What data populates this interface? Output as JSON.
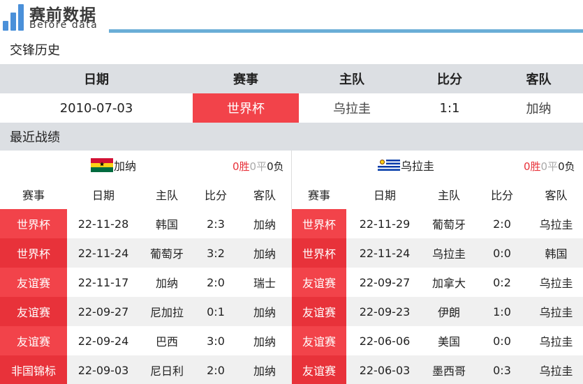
{
  "header": {
    "title": "赛前数据",
    "subtitle": "Before data",
    "accent": "#4a90d9"
  },
  "h2h": {
    "section_title": "交锋历史",
    "columns": [
      "日期",
      "赛事",
      "主队",
      "比分",
      "客队"
    ],
    "row": {
      "date": "2010-07-03",
      "competition": "世界杯",
      "home": "乌拉圭",
      "score": "1:1",
      "away": "加纳"
    }
  },
  "recent": {
    "section_title": "最近战绩",
    "columns": [
      "赛事",
      "日期",
      "主队",
      "比分",
      "客队"
    ],
    "left": {
      "team": "加纳",
      "flag": "ghana-flag",
      "record": {
        "win": "0胜",
        "draw": "0平",
        "loss": "0负"
      },
      "matches": [
        {
          "competition": "世界杯",
          "date": "22-11-28",
          "home": "韩国",
          "score": "2:3",
          "away": "加纳",
          "color": "#f2434a"
        },
        {
          "competition": "世界杯",
          "date": "22-11-24",
          "home": "葡萄牙",
          "score": "3:2",
          "away": "加纳",
          "color": "#e8323a"
        },
        {
          "competition": "友谊赛",
          "date": "22-11-17",
          "home": "加纳",
          "score": "2:0",
          "away": "瑞士",
          "color": "#f2434a"
        },
        {
          "competition": "友谊赛",
          "date": "22-09-27",
          "home": "尼加拉",
          "score": "0:1",
          "away": "加纳",
          "color": "#e8323a"
        },
        {
          "competition": "友谊赛",
          "date": "22-09-24",
          "home": "巴西",
          "score": "3:0",
          "away": "加纳",
          "color": "#f2434a"
        },
        {
          "competition": "非国锦标",
          "date": "22-09-03",
          "home": "尼日利",
          "score": "2:0",
          "away": "加纳",
          "color": "#e8323a"
        }
      ]
    },
    "right": {
      "team": "乌拉圭",
      "flag": "uruguay-flag",
      "record": {
        "win": "0胜",
        "draw": "0平",
        "loss": "0负"
      },
      "matches": [
        {
          "competition": "世界杯",
          "date": "22-11-29",
          "home": "葡萄牙",
          "score": "2:0",
          "away": "乌拉圭",
          "color": "#f2434a"
        },
        {
          "competition": "世界杯",
          "date": "22-11-24",
          "home": "乌拉圭",
          "score": "0:0",
          "away": "韩国",
          "color": "#e8323a"
        },
        {
          "competition": "友谊赛",
          "date": "22-09-27",
          "home": "加拿大",
          "score": "0:2",
          "away": "乌拉圭",
          "color": "#f2434a"
        },
        {
          "competition": "友谊赛",
          "date": "22-09-23",
          "home": "伊朗",
          "score": "1:0",
          "away": "乌拉圭",
          "color": "#e8323a"
        },
        {
          "competition": "友谊赛",
          "date": "22-06-06",
          "home": "美国",
          "score": "0:0",
          "away": "乌拉圭",
          "color": "#f2434a"
        },
        {
          "competition": "友谊赛",
          "date": "22-06-03",
          "home": "墨西哥",
          "score": "0:3",
          "away": "乌拉圭",
          "color": "#e8323a"
        }
      ]
    }
  }
}
